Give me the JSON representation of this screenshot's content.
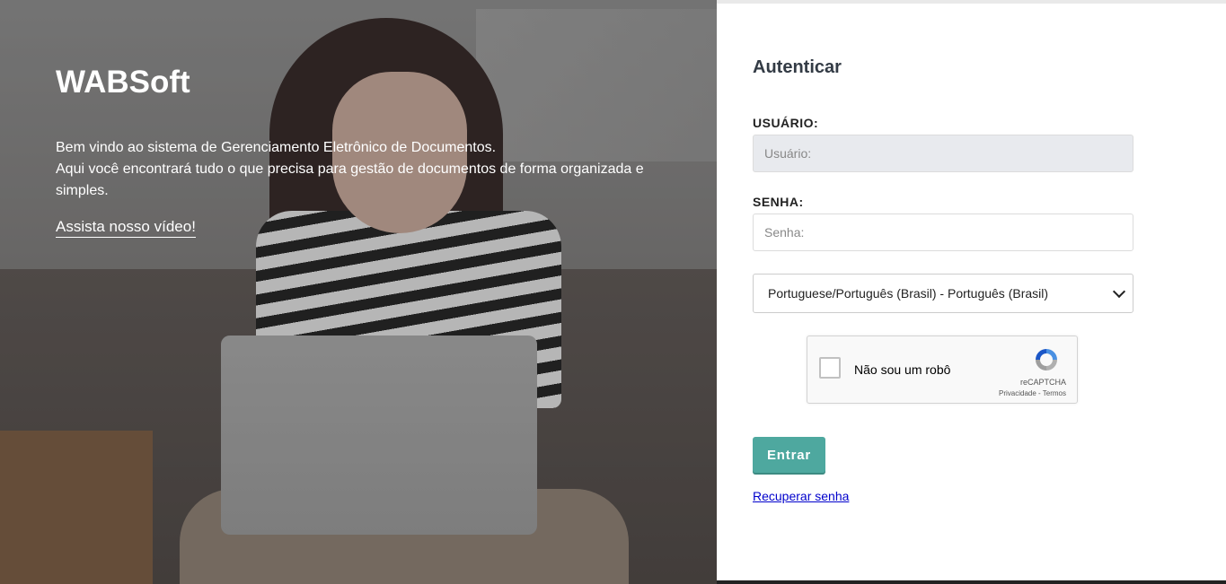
{
  "hero": {
    "brand": "WABSoft",
    "welcome_line1": "Bem vindo ao sistema de Gerenciamento Eletrônico de Documentos.",
    "welcome_line2": "Aqui você encontrará tudo o que precisa para gestão de documentos de forma organizada e simples.",
    "video_link": "Assista nosso vídeo!"
  },
  "login": {
    "title": "Autenticar",
    "user_label": "USUÁRIO:",
    "user_placeholder": "Usuário:",
    "user_value": "",
    "password_label": "SENHA:",
    "password_placeholder": "Senha:",
    "password_value": "",
    "language_selected": "Portuguese/Português (Brasil) - Português (Brasil)",
    "captcha": {
      "label": "Não sou um robô",
      "brand": "reCAPTCHA",
      "privacy": "Privacidade",
      "separator": " - ",
      "terms": "Termos",
      "checked": false
    },
    "submit_label": "Entrar",
    "recover_link": "Recuperar senha"
  },
  "colors": {
    "accent": "#4ea89f",
    "title": "#333b45",
    "link": "#0000cc"
  },
  "icons": {
    "captcha_logo": "recaptcha-logo-icon",
    "select_arrow": "chevron-down-icon"
  }
}
